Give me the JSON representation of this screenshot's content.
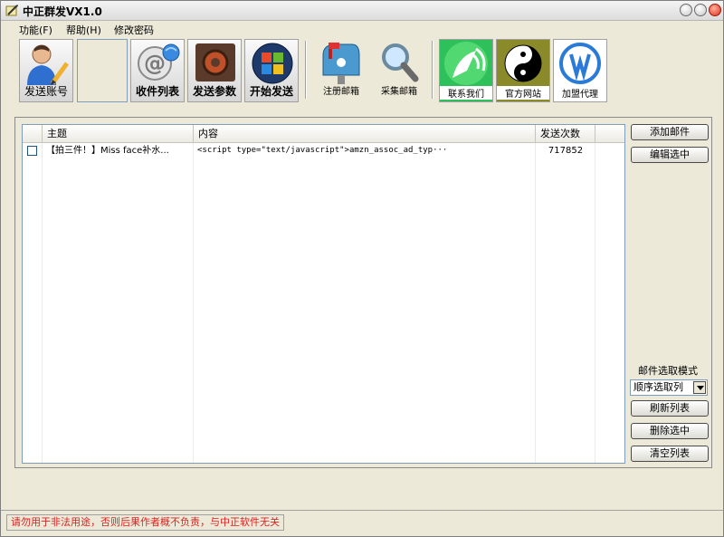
{
  "window": {
    "title": "中正群发VX1.0"
  },
  "menu": [
    {
      "label": "功能(F)"
    },
    {
      "label": "帮助(H)"
    },
    {
      "label": "修改密码"
    }
  ],
  "toolbar": {
    "send_account": "发送账号",
    "inbox_list": "收件列表",
    "send_params": "发送参数",
    "start_send": "开始发送",
    "register_mail": "注册邮箱",
    "collect_mail": "采集邮箱",
    "contact_us": "联系我们",
    "official_site": "官方网站",
    "join_agent": "加盟代理"
  },
  "table": {
    "columns": [
      "主题",
      "内容",
      "发送次数"
    ],
    "rows": [
      {
        "checked": false,
        "subject": "【拍三件！】Miss face补水...",
        "content": "<script type=\"text/javascript\">amzn_assoc_ad_typ···",
        "count": "717852"
      }
    ]
  },
  "side": {
    "add_mail": "添加邮件",
    "edit_selected": "编辑选中",
    "mode_label": "邮件选取模式",
    "mode_value": "顺序选取列",
    "refresh": "刷新列表",
    "delete_selected": "删除选中",
    "clear_list": "清空列表"
  },
  "status": {
    "text": "请勿用于非法用途，否则后果作者概不负责，与中正软件无关"
  },
  "colors": {
    "status_text": "#e02020",
    "window_bg": "#ECE9D8"
  }
}
